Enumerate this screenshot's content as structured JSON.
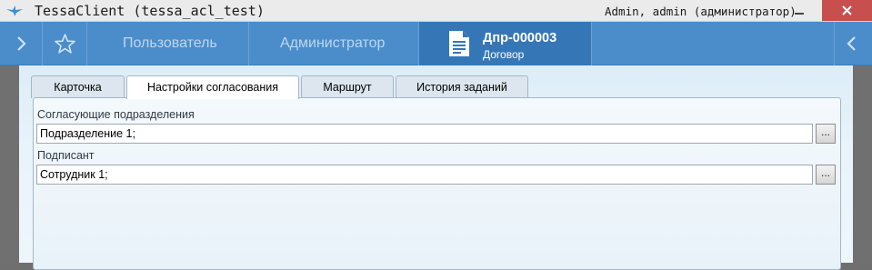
{
  "window": {
    "title": "TessaClient (tessa_acl_test)",
    "user": "Admin, admin (администратор)",
    "icon": "tessa-bird-icon"
  },
  "nav": {
    "left_icon": "chevron-right-icon",
    "star_icon": "star-icon",
    "user_label": "Пользователь",
    "admin_label": "Администратор",
    "doc_number": "Дпр-000003",
    "doc_type": "Договор",
    "doc_icon": "document-icon",
    "right_icon": "chevron-left-icon"
  },
  "tabs": [
    {
      "label": "Карточка",
      "active": false
    },
    {
      "label": "Настройки согласования",
      "active": true
    },
    {
      "label": "Маршрут",
      "active": false
    },
    {
      "label": "История заданий",
      "active": false
    }
  ],
  "form": {
    "departments": {
      "label": "Согласующие подразделения",
      "value": "Подразделение 1;",
      "button": "..."
    },
    "signer": {
      "label": "Подписант",
      "value": "Сотрудник 1;",
      "button": "..."
    }
  },
  "colors": {
    "nav_bg": "#4b8dca",
    "nav_active": "#3577b6",
    "close_button": "#c7504f"
  }
}
